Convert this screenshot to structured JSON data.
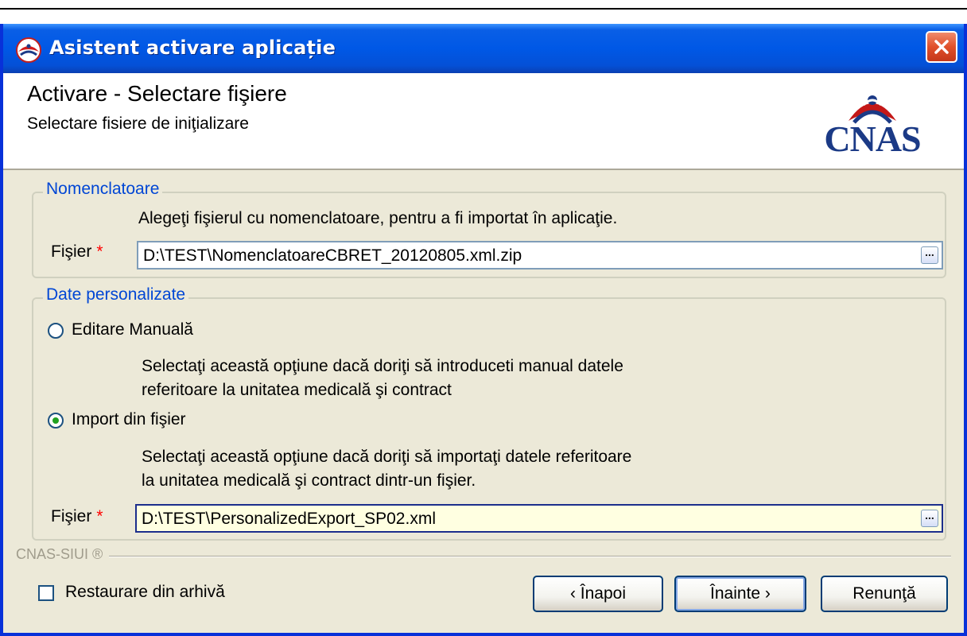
{
  "window": {
    "title": "Asistent activare aplicație"
  },
  "header": {
    "title": "Activare - Selectare fişiere",
    "subtitle": "Selectare fisiere de iniţializare",
    "logo_text": "CNAS"
  },
  "nomenclatoare": {
    "legend": "Nomenclatoare",
    "instruction": "Alegeţi fişierul cu nomenclatoare, pentru a fi importat în aplicaţie.",
    "file_label": "Fişier",
    "required_mark": "*",
    "file_value": "D:\\TEST\\NomenclatoareCBRET_20120805.xml.zip",
    "browse_label": "..."
  },
  "date_personalizate": {
    "legend": "Date personalizate",
    "options": [
      {
        "label": "Editare Manuală",
        "selected": false,
        "description_line1": "Selectaţi această opţiune dacă doriţi să introduceti manual datele",
        "description_line2": "referitoare la unitatea medicală şi contract"
      },
      {
        "label": "Import din fişier",
        "selected": true,
        "description_line1": "Selectaţi această opţiune dacă doriţi să importaţi datele referitoare",
        "description_line2": "la unitatea medicală şi contract dintr-un fişier."
      }
    ],
    "file_label": "Fişier",
    "required_mark": "*",
    "file_value": "D:\\TEST\\PersonalizedExport_SP02.xml",
    "browse_label": "..."
  },
  "footer": {
    "brand": "CNAS-SIUI ®",
    "restore_label": "Restaurare din arhivă",
    "restore_checked": false,
    "back_label": "‹ Înapoi",
    "next_label": "Înainte ›",
    "cancel_label": "Renunţă"
  },
  "colors": {
    "titlebar": "#0058e6",
    "legend": "#0046d5",
    "required": "#ff0000",
    "logo": "#1b3a86",
    "focused_input_bg": "#ffffe1"
  }
}
